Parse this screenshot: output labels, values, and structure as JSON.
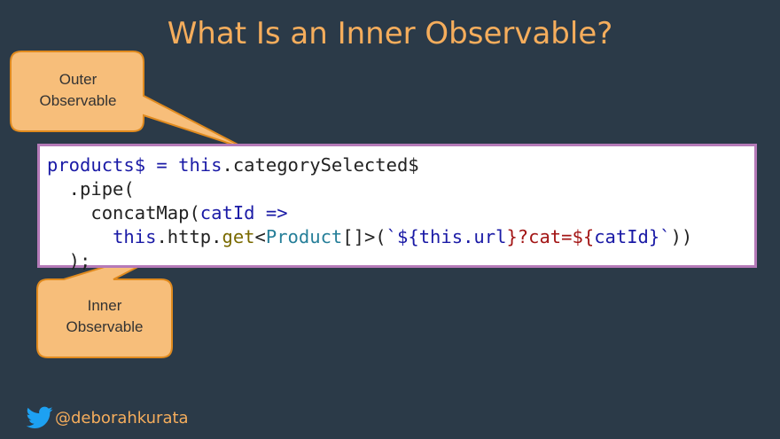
{
  "slide": {
    "title": "What Is an Inner Observable?",
    "handle": "@deborahkurata"
  },
  "callouts": {
    "outer_line1": "Outer",
    "outer_line2": "Observable",
    "inner_line1": "Inner",
    "inner_line2": "Observable"
  },
  "code": {
    "l1_a": "products$ = ",
    "l1_b": "this",
    "l1_c": ".categorySelected$",
    "l2_a": "  .pipe(",
    "l3_a": "    concatMap(",
    "l3_b": "catId",
    "l3_c": " =>",
    "l4_a": "      ",
    "l4_b": "this",
    "l4_c": ".http.",
    "l4_d": "get",
    "l4_e": "<",
    "l4_f": "Product",
    "l4_g": "[]>(",
    "l4_h": "`${",
    "l4_i": "this",
    "l4_j": ".url",
    "l4_k": "}?cat=${",
    "l4_l": "catId",
    "l4_m": "}`",
    "l4_n": "))",
    "l5_a": "  );"
  },
  "colors": {
    "background": "#2b3a48",
    "accent": "#f5ad5c",
    "callout_fill": "#f7be7a",
    "callout_stroke": "#e08a1e",
    "code_border": "#b57ab8",
    "twitter": "#1da1f2"
  },
  "icons": {
    "twitter": "twitter-bird-icon"
  }
}
